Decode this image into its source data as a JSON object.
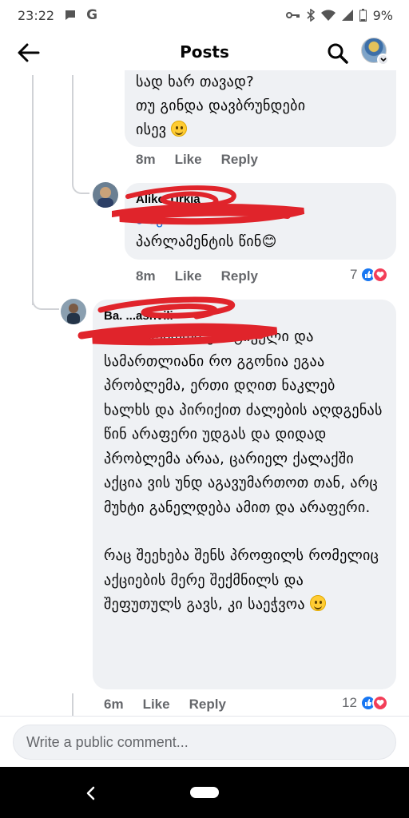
{
  "status_bar": {
    "time": "23:22",
    "battery": "9%"
  },
  "header": {
    "title": "Posts"
  },
  "comments": [
    {
      "text": "სად ხარ თავად?\nთუ გინდა დავბრუნდები\nისევ",
      "time": "8m",
      "like_label": "Like",
      "reply_label": "Reply"
    },
    {
      "author": "Aliko Tirkia",
      "mention": "ა ძე",
      "text": "პარლამენტის წინ😊",
      "time": "8m",
      "like_label": "Like",
      "reply_label": "Reply",
      "reaction_count": "7"
    },
    {
      "author": "Ba. ...ashvili",
      "mention": "ა ძე",
      "text_p1": " აპრიორი კრიტიკული და სამართლიანი რო გგონია ეგაა პრობლემა, ერთი დღით ნაკლებ ხალხს და პირიქით ძალების აღდგენას წინ არაფერი უდგას და დიდად პრობლემა არაა, ცარიელ ქალაქში აქცია ვის უნდ აგავუმართოთ თან, არც მუხტი განელდება ამით და არაფერი.",
      "text_p2": "რაც შეეხება შენს პროფილს რომელიც აქციების მერე შექმნილს და შეფუთულს გავს, კი საეჭვოა",
      "time": "6m",
      "like_label": "Like",
      "reply_label": "Reply",
      "reaction_count": "12"
    }
  ],
  "composer": {
    "placeholder": "Write a public comment..."
  },
  "icons": [
    "back-arrow-icon",
    "search-icon",
    "chevron-down-icon",
    "like-icon",
    "love-icon",
    "smiley-icon",
    "nav-back-icon"
  ],
  "colors": {
    "bubble": "#eff1f4",
    "mention": "#1a6ed8",
    "meta": "#65676b",
    "like": "#1877f2",
    "love": "#f33e58",
    "redact": "#e0242b"
  }
}
